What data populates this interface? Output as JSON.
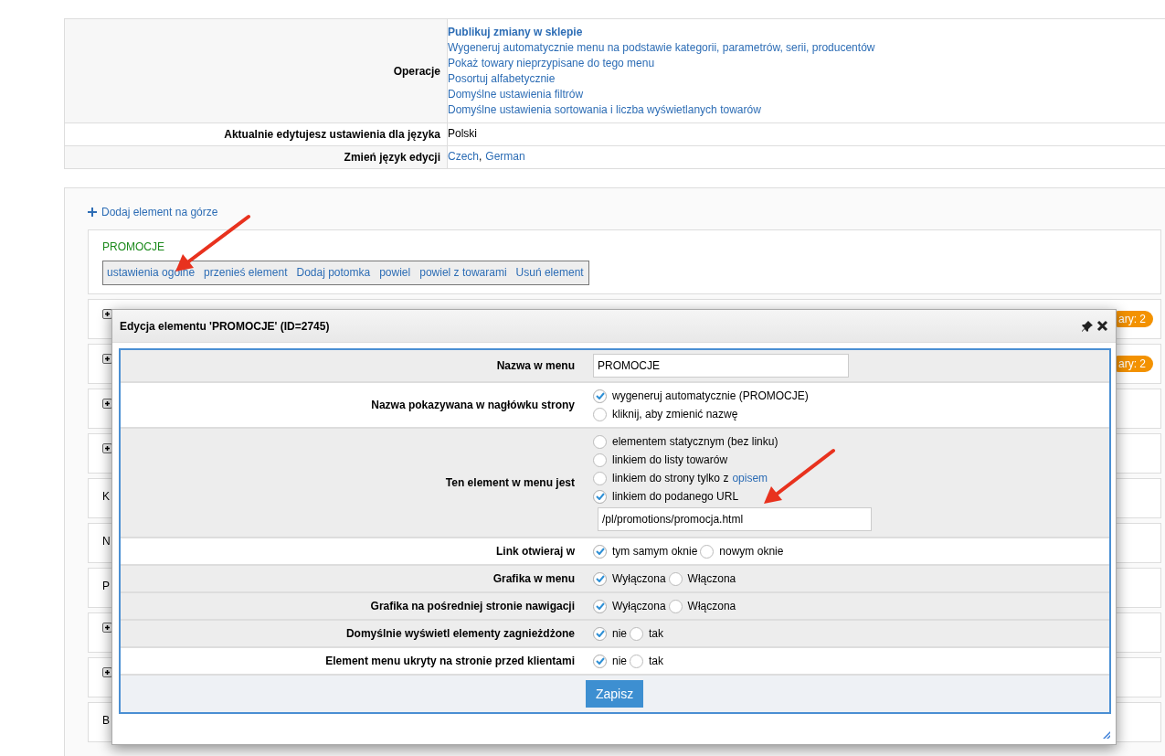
{
  "settings_table": {
    "rows": [
      {
        "kind": "link_list",
        "label": "Operacje",
        "links": [
          {
            "text": "Publikuj zmiany w sklepie",
            "bold": true
          },
          {
            "text": "Wygeneruj automatycznie menu na podstawie kategorii, parametrów, serii, producentów",
            "bold": false
          },
          {
            "text": "Pokaż towary nieprzypisane do tego menu",
            "bold": false
          },
          {
            "text": "Posortuj alfabetycznie",
            "bold": false
          },
          {
            "text": "Domyślne ustawienia filtrów",
            "bold": false
          },
          {
            "text": "Domyślne ustawienia sortowania i liczba wyświetlanych towarów",
            "bold": false
          }
        ]
      },
      {
        "kind": "text",
        "label": "Aktualnie edytujesz ustawienia dla języka",
        "value": "Polski"
      },
      {
        "kind": "inline_links",
        "label": "Zmień język edycji",
        "links": [
          "Czech",
          "German"
        ],
        "separator": ","
      }
    ]
  },
  "menu_panel": {
    "add_top_link": "Dodaj element na górze",
    "expanded_item": {
      "name": "PROMOCJE",
      "actions": [
        "ustawienia ogólne",
        "przenieś element",
        "Dodaj potomka",
        "powiel",
        "powiel z towarami",
        "Usuń element"
      ]
    },
    "items": [
      {
        "kind": "expander",
        "badge": "ary: 2"
      },
      {
        "kind": "expander",
        "badge": "ary: 2"
      },
      {
        "kind": "expander"
      },
      {
        "kind": "expander"
      },
      {
        "kind": "text",
        "text": "K"
      },
      {
        "kind": "text",
        "text": "N"
      },
      {
        "kind": "text",
        "text": "P"
      },
      {
        "kind": "expander"
      },
      {
        "kind": "expander"
      },
      {
        "kind": "text",
        "text": "B"
      }
    ]
  },
  "modal": {
    "title": "Edycja elementu 'PROMOCJE' (ID=2745)",
    "fields": [
      {
        "kind": "input",
        "label": "Nazwa w menu",
        "value": "PROMOCJE",
        "shaded": true
      },
      {
        "kind": "radio_list",
        "label": "Nazwa pokazywana w nagłówku strony",
        "shaded": false,
        "options": [
          {
            "label": "wygeneruj automatycznie (PROMOCJE)",
            "selected": true
          },
          {
            "label": "kliknij, aby zmienić nazwę",
            "selected": false
          }
        ]
      },
      {
        "kind": "radio_list",
        "label": "Ten element w menu jest",
        "shaded": true,
        "options": [
          {
            "label": "elementem statycznym (bez linku)",
            "selected": false
          },
          {
            "label": "linkiem do listy towarów",
            "selected": false
          },
          {
            "label": "linkiem do strony tylko z",
            "link": "opisem",
            "selected": false
          },
          {
            "label": "linkiem do podanego URL",
            "selected": true
          }
        ],
        "url_value": "/pl/promotions/promocja.html"
      },
      {
        "kind": "radio_inline",
        "label": "Link otwieraj w",
        "shaded": false,
        "options": [
          {
            "label": "tym samym oknie",
            "selected": true
          },
          {
            "label": "nowym oknie",
            "selected": false
          }
        ]
      },
      {
        "kind": "radio_inline",
        "label": "Grafika w menu",
        "shaded": true,
        "options": [
          {
            "label": "Wyłączona",
            "selected": true
          },
          {
            "label": "Włączona",
            "selected": false
          }
        ]
      },
      {
        "kind": "radio_inline",
        "label": "Grafika na pośredniej stronie nawigacji",
        "shaded": true,
        "options": [
          {
            "label": "Wyłączona",
            "selected": true
          },
          {
            "label": "Włączona",
            "selected": false
          }
        ]
      },
      {
        "kind": "radio_inline",
        "label": "Domyślnie wyświetl elementy zagnieżdżone",
        "shaded": true,
        "options": [
          {
            "label": "nie",
            "selected": true
          },
          {
            "label": "tak",
            "selected": false
          }
        ]
      },
      {
        "kind": "radio_inline",
        "label": "Element menu ukryty na stronie przed klientami",
        "shaded": false,
        "options": [
          {
            "label": "nie",
            "selected": true
          },
          {
            "label": "tak",
            "selected": false
          }
        ]
      }
    ],
    "save_button": "Zapisz"
  }
}
